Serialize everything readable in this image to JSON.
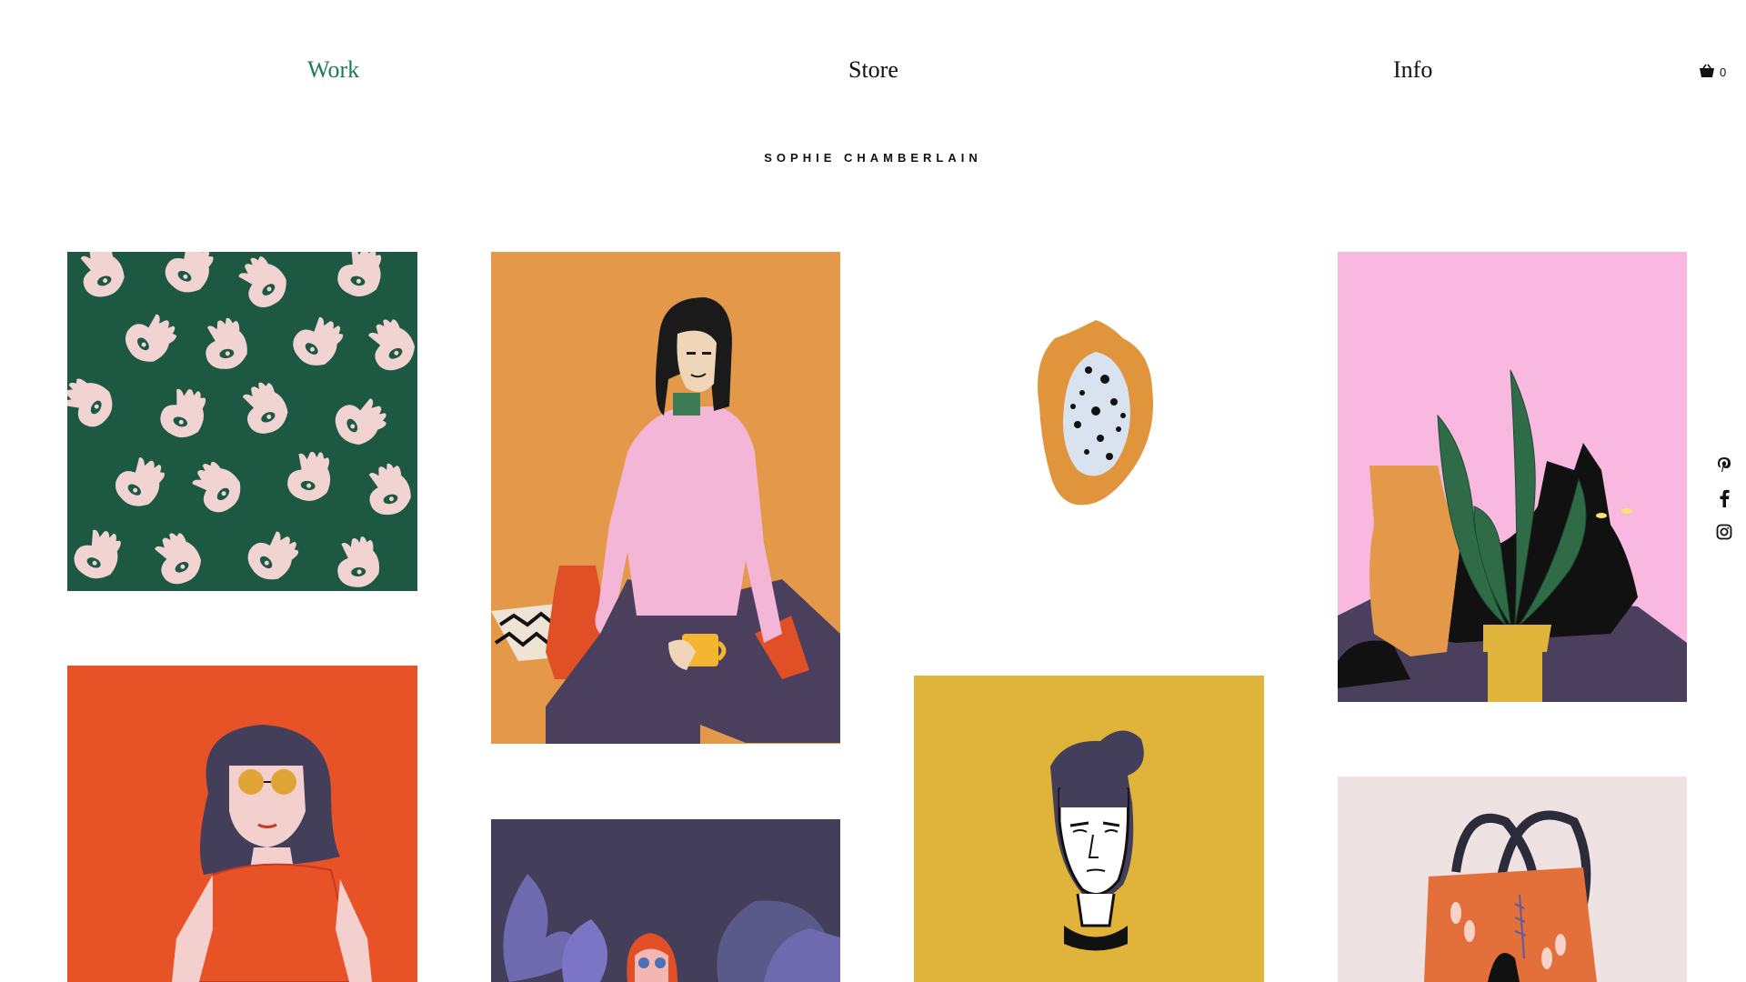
{
  "nav": {
    "items": [
      {
        "label": "Work",
        "active": true
      },
      {
        "label": "Store",
        "active": false
      },
      {
        "label": "Info",
        "active": false
      }
    ],
    "active_color": "#1e7a56"
  },
  "cart": {
    "icon": "basket-icon",
    "count": "0"
  },
  "brand": {
    "title": "SOPHIE CHAMBERLAIN"
  },
  "gallery": {
    "items": [
      {
        "name": "hands-eyes-pattern",
        "bg": "#1c5842"
      },
      {
        "name": "woman-pink-sweater-mug",
        "bg": "#e3984a"
      },
      {
        "name": "papaya",
        "bg": "#ffffff"
      },
      {
        "name": "black-cat-plant-vase",
        "bg": "#f9b8e0"
      },
      {
        "name": "woman-sunglasses-orange",
        "bg": "#e85227"
      },
      {
        "name": "woman-leaves-purple",
        "bg": "#433e5a"
      },
      {
        "name": "portrait-yellow",
        "bg": "#e0b43a"
      },
      {
        "name": "tote-bag",
        "bg": "#efe2e3"
      }
    ]
  },
  "social": [
    {
      "icon": "pinterest-icon"
    },
    {
      "icon": "facebook-icon"
    },
    {
      "icon": "instagram-icon"
    }
  ]
}
